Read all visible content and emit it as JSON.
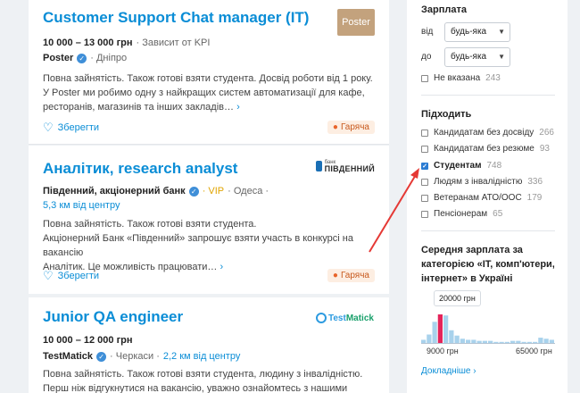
{
  "jobs": [
    {
      "title": "Customer Support Chat manager (IT)",
      "salary": "10 000 – 13 000 грн",
      "salary_note": "· Зависит от KPI",
      "company": "Poster",
      "location": "· Дніпро",
      "logo_text": "Poster",
      "description": [
        "Повна зайнятість. Також готові взяти студента. Досвід роботи від 1 року.",
        "У Poster ми робимо одну з найкращих систем автоматизації для кафе,",
        "ресторанів, магазинів та інших закладів…"
      ],
      "more": "›",
      "save_label": "Зберегти",
      "hot_label": "Гаряча"
    },
    {
      "title": "Аналітик, research analyst",
      "company": "Південний, акціонерний банк",
      "vip": "· VIP",
      "location": "· Одеса ·",
      "distance": "5,3 км від центру",
      "logo_small": "банк",
      "logo_big": "ПІВДЕННИЙ",
      "description": [
        "Повна зайнятість. Також готові взяти студента.",
        "Акціонерний Банк «Південний» запрошує взяти участь в конкурсі на вакансію",
        "Аналітик. Це можливість працювати…"
      ],
      "more": "›",
      "save_label": "Зберегти",
      "hot_label": "Гаряча"
    },
    {
      "title": "Junior QA engineer",
      "salary": "10 000 – 12 000 грн",
      "company": "TestMatick",
      "location": "· Черкаси ·",
      "distance": "2,2 км від центру",
      "logo_text_1": "Test",
      "logo_text_2": "Matick",
      "description": [
        "Повна зайнятість. Також готові взяти студента, людину з інвалідністю.",
        "Перш ніж відгукнутися на вакансію, уважно ознайомтесь з нашими головними"
      ]
    }
  ],
  "sidebar": {
    "salary_heading": "Зарплата",
    "from_label": "від",
    "from_value": "будь-яка",
    "to_label": "до",
    "to_value": "будь-яка",
    "not_specified": {
      "label": "Не вказана",
      "count": "243"
    },
    "fits_heading": "Підходить",
    "fits": [
      {
        "label": "Кандидатам без досвіду",
        "count": "266",
        "checked": false
      },
      {
        "label": "Кандидатам без резюме",
        "count": "93",
        "checked": false
      },
      {
        "label": "Студентам",
        "count": "748",
        "checked": true
      },
      {
        "label": "Людям з інвалідністю",
        "count": "336",
        "checked": false
      },
      {
        "label": "Ветеранам АТО/ООС",
        "count": "179",
        "checked": false
      },
      {
        "label": "Пенсіонерам",
        "count": "65",
        "checked": false
      }
    ],
    "stat_heading": "Середня зарплата за категорією «IT, комп'ютери, інтернет» в Україні",
    "stat_bubble": "20000 грн",
    "axis_min": "9000 грн",
    "axis_max": "65000 грн",
    "more_link": "Докладніше ›"
  },
  "chart_data": {
    "type": "bar",
    "values": [
      3,
      8,
      20,
      27,
      26,
      12,
      7,
      4,
      3,
      3,
      2,
      2,
      2,
      1,
      1,
      1,
      2,
      2,
      1,
      1,
      1,
      5,
      4,
      3
    ],
    "highlight_index": 3,
    "highlight_color": "#e4245a",
    "bar_color": "#a8d2ec",
    "xlim": [
      "9000 грн",
      "65000 грн"
    ],
    "annotation": "20000 грн"
  },
  "colors": {
    "link": "#0a8dd6",
    "hot_bg": "#fdeee2",
    "arrow": "#e53935"
  }
}
